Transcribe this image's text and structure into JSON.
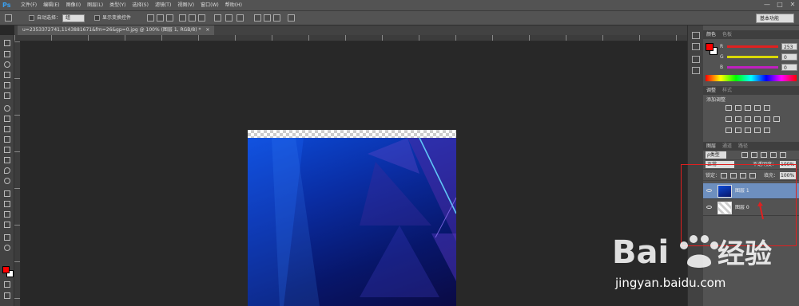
{
  "app": {
    "logo": "Ps",
    "menu": [
      "文件(F)",
      "编辑(E)",
      "图像(I)",
      "图层(L)",
      "类型(Y)",
      "选择(S)",
      "滤镜(T)",
      "视图(V)",
      "窗口(W)",
      "帮助(H)"
    ],
    "window_controls": [
      "—",
      "□",
      "✕"
    ]
  },
  "options": {
    "auto_select_label": "自动选择：",
    "auto_select_value": "组",
    "show_transform_label": "显示变换控件",
    "workspace": "基本功能"
  },
  "document": {
    "tab_title": "u=2353372741,1143881671&fm=26&gp=0.jpg @ 100% (图层 1, RGB/8) *",
    "tab_close": "×"
  },
  "panels": {
    "color": {
      "tabs": [
        "颜色",
        "色板"
      ],
      "rows": [
        {
          "label": "R",
          "value": "253",
          "color": "#e02020"
        },
        {
          "label": "G",
          "value": "0",
          "color": "#d8d800"
        },
        {
          "label": "B",
          "value": "0",
          "color": "#c020c0"
        }
      ],
      "foreground": "#ff0000",
      "background": "#ffffff"
    },
    "adjustments": {
      "tabs": [
        "调整",
        "样式"
      ],
      "title": "添加调整"
    },
    "layers": {
      "tabs": [
        "图层",
        "通道",
        "路径"
      ],
      "filter_label": "ρ类型",
      "blend_mode": "正常",
      "opacity_label": "不透明度：",
      "opacity_value": "100%",
      "lock_label": "锁定：",
      "fill_label": "填充：",
      "fill_value": "100%",
      "items": [
        {
          "name": "图层 1",
          "selected": true
        },
        {
          "name": "图层 0",
          "selected": false
        }
      ]
    }
  },
  "watermark": {
    "brand": "Bai",
    "brand_cn": "经验",
    "url": "jingyan.baidu.com"
  },
  "accent": {
    "highlight": "#e02020",
    "selected_layer": "#6d8fbf"
  }
}
